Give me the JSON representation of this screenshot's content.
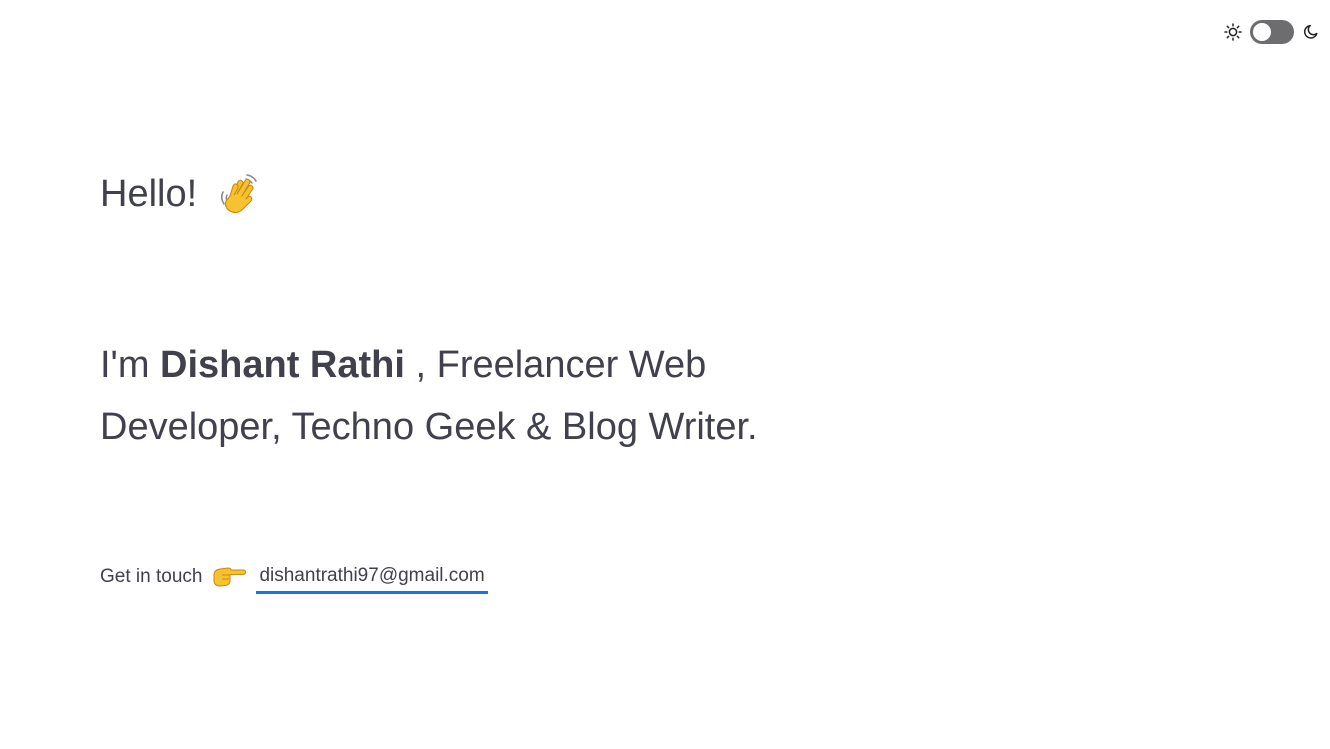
{
  "theme_toggle": {
    "light_icon": "sun-icon",
    "dark_icon": "moon-icon",
    "state": "light"
  },
  "hero": {
    "greeting": "Hello!",
    "greeting_emoji": "waving-hand-icon",
    "intro_prefix": "I'm ",
    "name": "Dishant Rathi",
    "intro_suffix": " , Freelancer Web Developer, Techno Geek & Blog Writer."
  },
  "contact": {
    "label": "Get in touch",
    "pointer_emoji": "pointing-right-icon",
    "email": "dishantrathi97@gmail.com"
  },
  "colors": {
    "text": "#41414d",
    "accent_underline": "#1a73e8",
    "toggle_track": "#6d6d70"
  }
}
